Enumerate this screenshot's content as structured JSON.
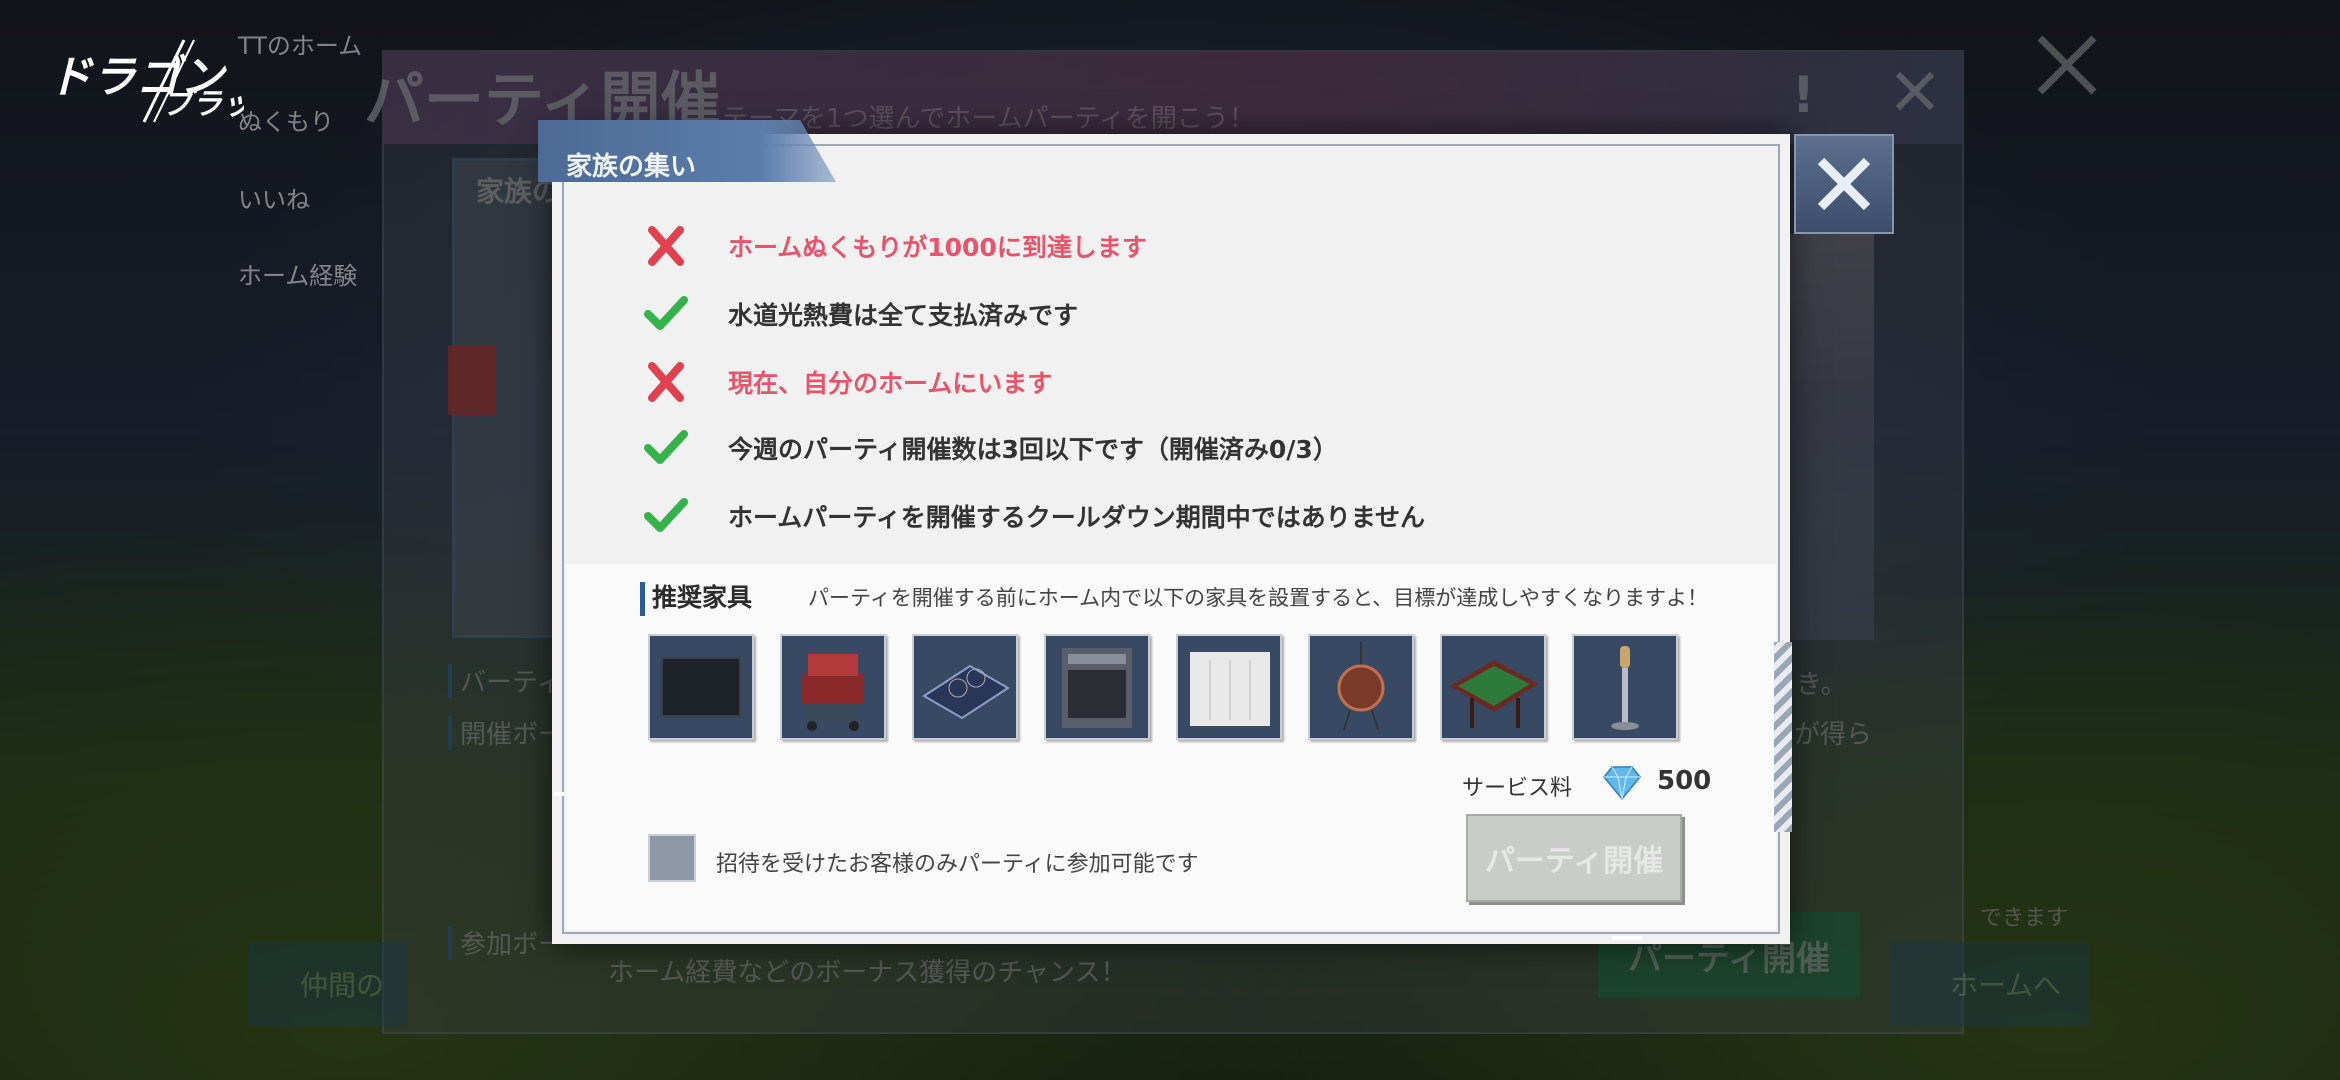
{
  "background": {
    "logo_text": "コード:ドラゴンブラッド",
    "side_items": [
      "TTのホーム",
      "ぬくもり",
      "いいね",
      "ホーム経験"
    ],
    "panel_title": "パーティ開催",
    "panel_subtitle": "テーマを1つ選んでホームパーティを開こう！",
    "panel_excl": "!",
    "card_label": "家族の",
    "lines": [
      {
        "text": "バーティ",
        "y": 0
      },
      {
        "text": "開催ボー",
        "y": 0
      },
      {
        "text": "参加ボー",
        "y": 0
      }
    ],
    "right_fragment_1": "き。",
    "right_fragment_2": "が得ら",
    "bonus_line": "ホーム経費などのボーナス獲得のチャンス！",
    "host_button": "パーティ開催",
    "right_button": "ホームへ",
    "left_button": "仲間の",
    "hint_right": "できます"
  },
  "dialog": {
    "title": "家族の集い",
    "conditions": [
      {
        "met": false,
        "text": "ホームぬくもりが1000に到達します"
      },
      {
        "met": true,
        "text": "水道光熱費は全て支払済みです"
      },
      {
        "met": false,
        "text": "現在、自分のホームにいます"
      },
      {
        "met": true,
        "text": "今週のパーティ開催数は3回以下です（開催済み0/3）"
      },
      {
        "met": true,
        "text": "ホームパーティを開催するクールダウン期間中ではありません"
      }
    ],
    "recommended": {
      "title": "推奨家具",
      "description": "パーティを開催する前にホーム内で以下の家具を設置すると、目標が達成しやすくなりますよ！",
      "items": [
        "tv-icon",
        "grill-icon",
        "induction-cooktop-icon",
        "oven-icon",
        "cabinet-icon",
        "hanging-chair-icon",
        "foosball-table-icon",
        "microphone-stand-icon",
        "partial-item-icon"
      ]
    },
    "fee": {
      "label": "サービス料",
      "value": "500",
      "currency_icon": "diamond-icon"
    },
    "invite_only_label": "招待を受けたお客様のみパーティに参加可能です",
    "invite_only_checked": false,
    "host_button": "パーティ開催"
  },
  "colors": {
    "met": "#34b34a",
    "not_met": "#e9546b",
    "accent": "#4c6a94"
  }
}
